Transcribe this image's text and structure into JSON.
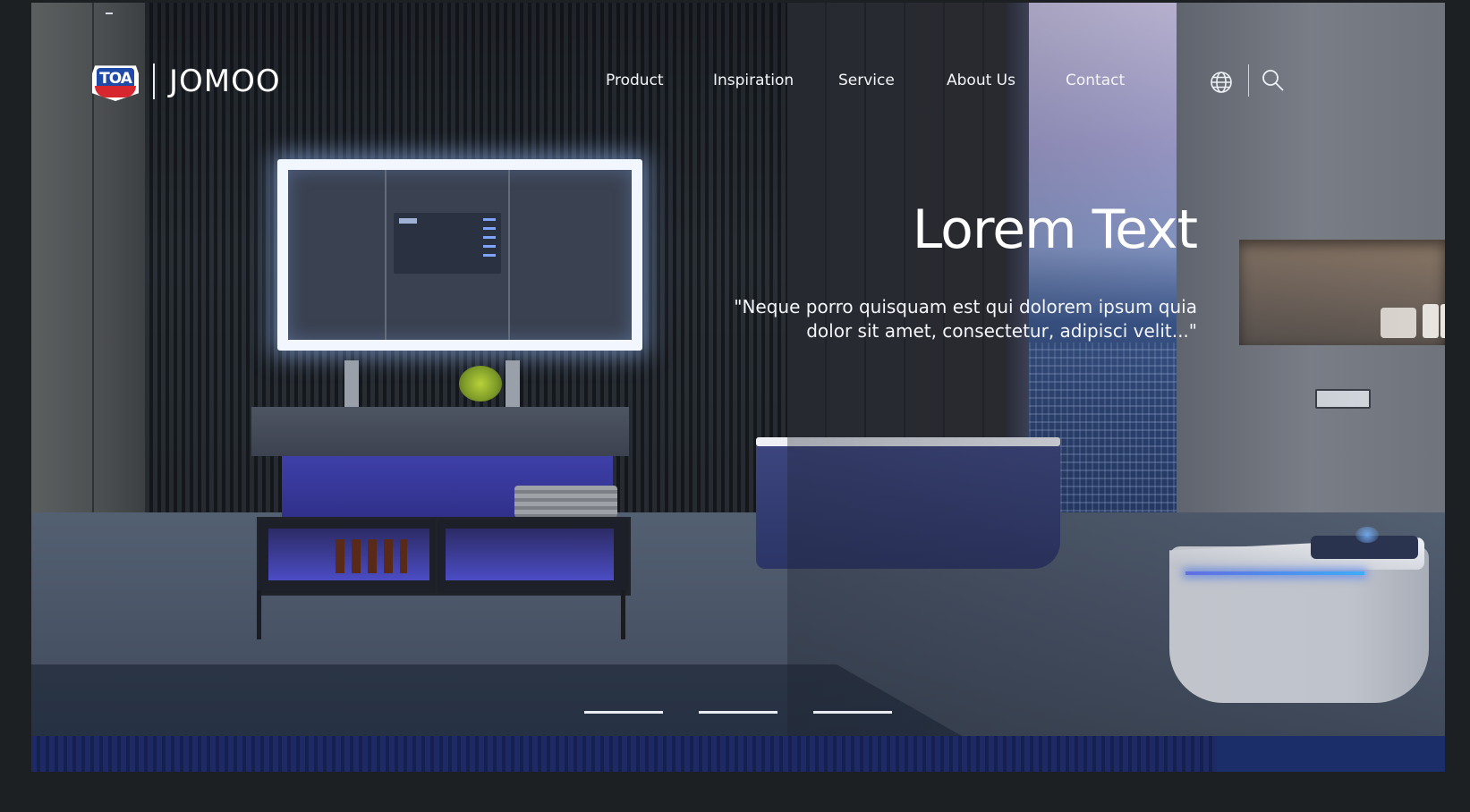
{
  "brand": {
    "badge_text": "TOA",
    "wordmark": "JOMOO",
    "badge_colors": {
      "red": "#d8262f",
      "blue": "#1f4aa8"
    }
  },
  "nav": {
    "items": [
      {
        "label": "Product"
      },
      {
        "label": "Inspiration"
      },
      {
        "label": "Service"
      },
      {
        "label": "About Us"
      },
      {
        "label": "Contact"
      }
    ]
  },
  "header_icons": [
    {
      "icon": "globe-icon"
    },
    {
      "icon": "search-icon"
    }
  ],
  "hero": {
    "title": "Lorem Text",
    "subtitle_line1": "\"Neque porro quisquam est qui dolorem ipsum quia",
    "subtitle_line2": "dolor sit amet, consectetur, adipisci velit...\""
  },
  "carousel": {
    "slide_count": 3
  },
  "colors": {
    "text": "#ffffff",
    "accent_glow": "#4b4cc4"
  }
}
